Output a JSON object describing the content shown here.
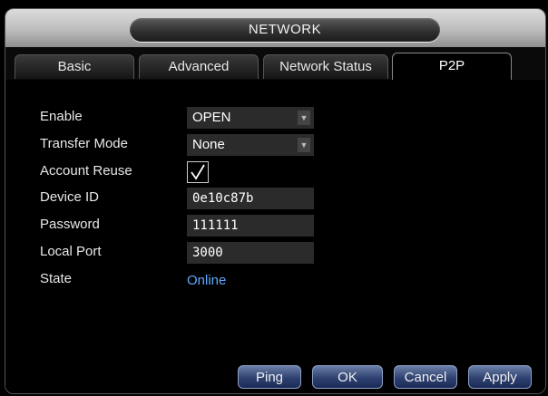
{
  "window": {
    "title": "NETWORK"
  },
  "tabs": [
    {
      "label": "Basic"
    },
    {
      "label": "Advanced"
    },
    {
      "label": "Network Status"
    },
    {
      "label": "P2P"
    }
  ],
  "form": {
    "enable": {
      "label": "Enable",
      "value": "OPEN"
    },
    "transfer_mode": {
      "label": "Transfer Mode",
      "value": "None"
    },
    "account_reuse": {
      "label": "Account Reuse",
      "checked": true
    },
    "device_id": {
      "label": "Device ID",
      "value": "0e10c87b"
    },
    "password": {
      "label": "Password",
      "value": "111111"
    },
    "local_port": {
      "label": "Local Port",
      "value": "3000"
    },
    "state": {
      "label": "State",
      "value": "Online"
    }
  },
  "buttons": {
    "ping": "Ping",
    "ok": "OK",
    "cancel": "Cancel",
    "apply": "Apply"
  },
  "colors": {
    "state_online": "#5fa8ff",
    "button_blue": "#2f4170",
    "field_bg": "#2b2b2b"
  },
  "icons": {
    "dropdown": "dropdown-arrow-icon",
    "check": "checkmark-icon"
  }
}
